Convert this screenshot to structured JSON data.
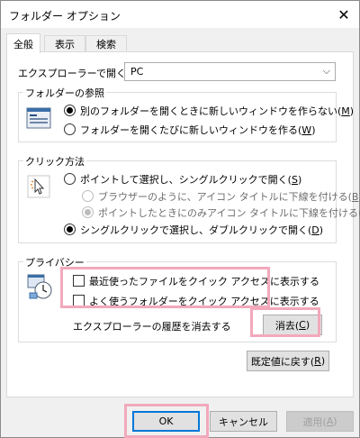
{
  "window": {
    "title": "フォルダー オプション",
    "close_label": "✕"
  },
  "tabs": [
    {
      "label": "全般",
      "active": true
    },
    {
      "label": "表示",
      "active": false
    },
    {
      "label": "検索",
      "active": false
    }
  ],
  "open_explorer": {
    "label": "エクスプローラーで開く:",
    "value": "PC",
    "arrow": "⌵"
  },
  "browse_folders": {
    "legend": "フォルダーの参照",
    "icon": "folder-window-icon",
    "option1": "別のフォルダーを開くときに新しいウィンドウを作らない(",
    "option1_key": "M",
    "option2": "フォルダーを開くたびに新しいウィンドウを作る(",
    "option2_key": "W"
  },
  "click_items": {
    "legend": "クリック方法",
    "icon": "pointer-click-icon",
    "single": "ポイントして選択し、シングルクリックで開く(",
    "single_key": "S",
    "sub1": "ブラウザーのように、アイコン タイトルに下線を付ける(",
    "sub1_key": "B",
    "sub2": "ポイントしたときにのみアイコン タイトルに下線を付ける(",
    "sub2_key": "P",
    "double": "シングルクリックで選択し、ダブルクリックで開く(",
    "double_key": "D"
  },
  "privacy": {
    "legend": "プライバシー",
    "icon": "privacy-clock-icon",
    "recent_files": "最近使ったファイルをクイック アクセスに表示する",
    "frequent_folders": "よく使うフォルダーをクイック アクセスに表示する",
    "clear_history_label": "エクスプローラーの履歴を消去する",
    "clear_button": "消去(",
    "clear_key": "C"
  },
  "restore_button": "既定値に戻す(",
  "restore_key": "R",
  "footer": {
    "ok": "OK",
    "cancel": "キャンセル",
    "apply": "適用(",
    "apply_key": "A"
  },
  "paren_close": ")",
  "colors": {
    "highlight": "#f2a9bb",
    "accent": "#0078d7"
  }
}
